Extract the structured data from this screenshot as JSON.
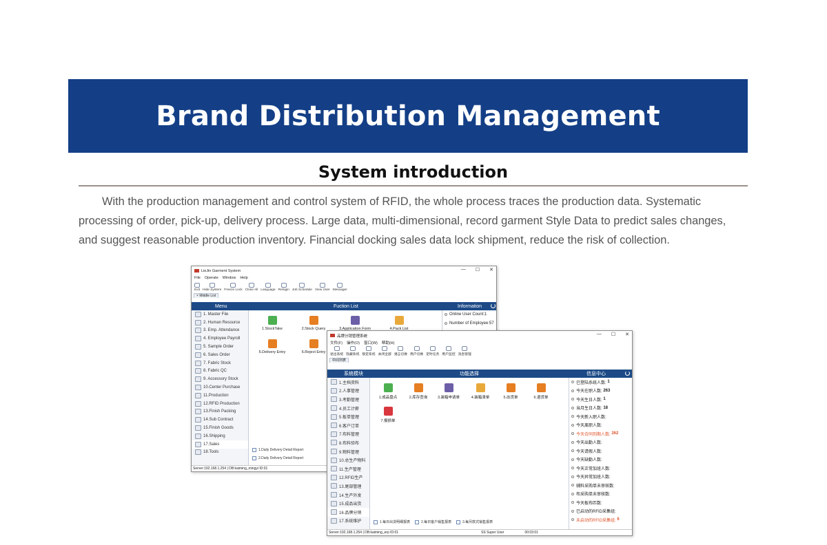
{
  "banner": {
    "title": "Brand Distribution Management"
  },
  "section": {
    "title": "System introduction",
    "intro": "With the production management and control system of RFID, the whole process traces the production data. Systematic processing of order, pick-up, delivery process. Large data, multi-dimensional, record garment Style Data to predict sales changes, and suggest reasonable production inventory. Financial docking sales data lock shipment, reduce the risk of collection."
  },
  "colors": {
    "banner": "#143f87",
    "panel_header": "#1d4a87",
    "highlight": "#e0552e"
  },
  "win1": {
    "title": "LieJin Garment System",
    "menu": [
      "File",
      "Operate",
      "Window",
      "Help"
    ],
    "toolbar": [
      "Exit",
      "Hide System",
      "Freeze Lock",
      "Close All",
      "Language",
      "Relogin",
      "Job Schedule",
      "View User",
      "Messager"
    ],
    "tab": "Middle List",
    "headers": {
      "menu": "Menu",
      "func": "Fuction List",
      "info": "Information"
    },
    "menu_items": [
      "1. Master File",
      "2. Human Resource",
      "3. Emp. Attendance",
      "4. Employee Payroll",
      "5. Sample Order",
      "6. Sales Order",
      "7. Fabric Stock",
      "8. Fabric QC",
      "9. Accessory Stock",
      "10.Center Purchase",
      "11.Production",
      "12.RFID Production",
      "13.Finish Packing",
      "14.Sub Contract",
      "15.Finish Goods",
      "16.Shipping",
      "17.Sales",
      "18.Tools"
    ],
    "functions": [
      "1.StockTake",
      "2.Stock Query",
      "3.Application Form",
      "4.Pack List",
      "5.Delivery Entry",
      "6.Reject Entry"
    ],
    "reports": [
      "1.Daily Delivery Detail Report",
      "2.Daily Delivery Detail Report"
    ],
    "info": [
      "Online User Count:1",
      "Number of Employee:57"
    ],
    "status": "Server:192.168.1.254 | DB:kaiming_mingyi ID:01"
  },
  "win2": {
    "title": "品牌分销管理系统",
    "menu": [
      "文件(F)",
      "操作(O)",
      "窗口(W)",
      "帮助(H)"
    ],
    "toolbar": [
      "退出系统",
      "隐藏系统",
      "锁定系统",
      "关闭全部",
      "语言切换",
      "用户切换",
      "定时任务",
      "用户监控",
      "消息管理"
    ],
    "tab": "中间列表",
    "headers": {
      "menu": "系统模块",
      "func": "功能选择",
      "info": "信息中心"
    },
    "menu_items": [
      "1.主档资料",
      "2.人事管理",
      "3.考勤管理",
      "4.员工计薪",
      "5.板单管理",
      "6.客户订单",
      "7.布料管理",
      "8.布料验布",
      "9.物料管理",
      "10.总生产物料",
      "11.生产管理",
      "12.RFID生产",
      "13.尾部管理",
      "14.生产外发",
      "15.成品出货",
      "16.品牌分销",
      "17.系统维护"
    ],
    "functions": [
      "1.成品盘点",
      "2.库存查询",
      "3.装箱申请单",
      "4.装箱清单",
      "5.出货单",
      "6.退货单",
      "7.报损单"
    ],
    "reports": [
      "1.每日出货明细报表",
      "2.每日客户销售报表",
      "3.每月款式销售报表"
    ],
    "info": [
      {
        "label": "已登陆系统人数:",
        "value": "1"
      },
      {
        "label": "今天在职人数:",
        "value": "263"
      },
      {
        "label": "今天生日人数:",
        "value": "1"
      },
      {
        "label": "当月生日人数:",
        "value": "18"
      },
      {
        "label": "今天新入职人数:",
        "value": ""
      },
      {
        "label": "今天离职人数:",
        "value": ""
      },
      {
        "label": "今天合同到期人数:",
        "value": "262"
      },
      {
        "label": "今天出勤人数:",
        "value": ""
      },
      {
        "label": "今天请假人数:",
        "value": ""
      },
      {
        "label": "今天缺勤人数:",
        "value": ""
      },
      {
        "label": "今天正常加班人数:",
        "value": ""
      },
      {
        "label": "今天异常加班人数:",
        "value": ""
      },
      {
        "label": "辅料采购单未审核数:",
        "value": ""
      },
      {
        "label": "布采购单未审核数:",
        "value": ""
      },
      {
        "label": "今天板布匹数:",
        "value": ""
      },
      {
        "label": "已启动的RFID采集组:",
        "value": ""
      },
      {
        "label": "未启动的RFID采集组:",
        "value": "6"
      }
    ],
    "status": "Server:192.168.1.254 | DB:kaiming_erp ID:01",
    "status_user": "SS Super User",
    "status_time": "00:03:01"
  }
}
